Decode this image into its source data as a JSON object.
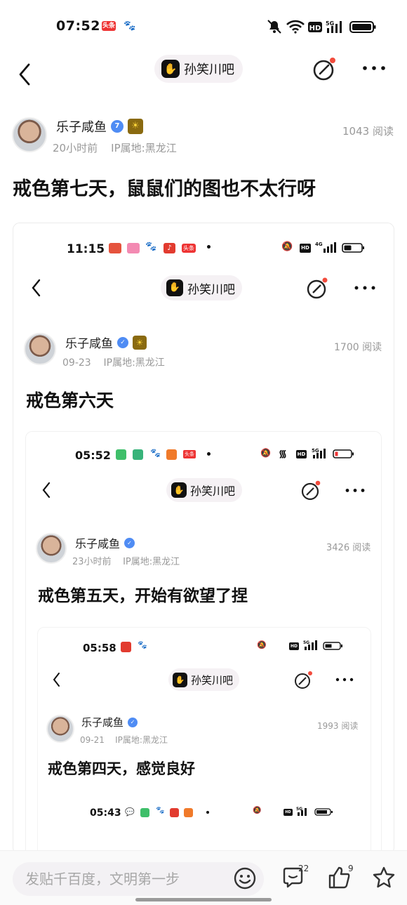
{
  "status_bar": {
    "time": "07:52",
    "app_badge": "头条"
  },
  "nav": {
    "forum_name": "孙笑川吧"
  },
  "post": {
    "author": "乐子咸鱼",
    "level_badge": "7",
    "time": "20小时前",
    "ip": "IP属地:黑龙江",
    "reads": "1043 阅读",
    "title": "戒色第七天，鼠鼠们的图也不太行呀"
  },
  "nested1": {
    "status_time": "11:15",
    "status_badge": "头条",
    "forum_name": "孙笑川吧",
    "author": "乐子咸鱼",
    "time": "09-23",
    "ip": "IP属地:黑龙江",
    "reads": "1700 阅读",
    "title": "戒色第六天"
  },
  "nested2": {
    "status_time": "05:52",
    "status_badge": "头条",
    "forum_name": "孙笑川吧",
    "author": "乐子咸鱼",
    "time": "23小时前",
    "ip": "IP属地:黑龙江",
    "reads": "3426 阅读",
    "title": "戒色第五天，开始有欲望了捏"
  },
  "nested3": {
    "status_time": "05:58",
    "forum_name": "孙笑川吧",
    "author": "乐子咸鱼",
    "time": "09-21",
    "ip": "IP属地:黑龙江",
    "reads": "1993 阅读",
    "title": "戒色第四天，感觉良好"
  },
  "nested4": {
    "status_time": "05:43"
  },
  "bottom_bar": {
    "input_placeholder": "发贴千百度，文明第一步",
    "comment_count": "22",
    "like_count": "9"
  },
  "colors": {
    "accent_dot": "#f24c3d",
    "verify_blue": "#4f8cf4"
  }
}
